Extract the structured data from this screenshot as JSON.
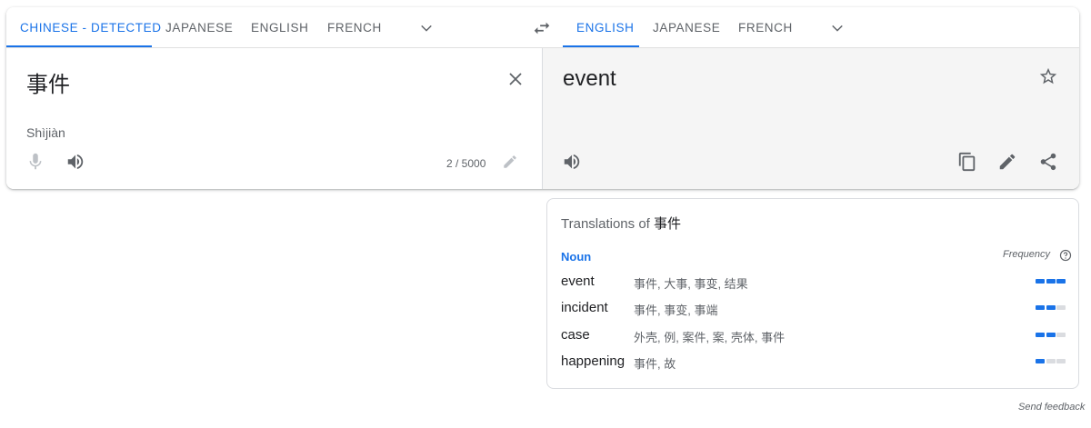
{
  "source_tabs": [
    {
      "label": "Chinese - detected",
      "active": true
    },
    {
      "label": "Japanese",
      "active": false
    },
    {
      "label": "English",
      "active": false
    },
    {
      "label": "French",
      "active": false
    }
  ],
  "target_tabs": [
    {
      "label": "English",
      "active": true
    },
    {
      "label": "Japanese",
      "active": false
    },
    {
      "label": "French",
      "active": false
    }
  ],
  "source": {
    "text": "事件",
    "romanization": "Shìjiàn",
    "char_count": "2 / 5000"
  },
  "target": {
    "text": "event"
  },
  "dictionary": {
    "title_prefix": "Translations of",
    "term": "事件",
    "part_of_speech": "Noun",
    "frequency_label": "Frequency",
    "entries": [
      {
        "word": "event",
        "synonyms": "事件, 大事, 事变, 结果",
        "frequency": 3
      },
      {
        "word": "incident",
        "synonyms": "事件, 事变, 事端",
        "frequency": 2
      },
      {
        "word": "case",
        "synonyms": "外壳, 例, 案件, 案, 壳体, 事件",
        "frequency": 2
      },
      {
        "word": "happening",
        "synonyms": "事件, 故",
        "frequency": 1
      }
    ]
  },
  "feedback": "Send feedback",
  "colors": {
    "accent": "#1a73e8",
    "muted": "#5f6368",
    "target_bg": "#f5f5f5",
    "bar_off": "#dadce0"
  },
  "icons": {
    "swap": "swap-horiz-icon",
    "clear": "close-icon",
    "mic": "mic-icon",
    "speaker": "volume-up-icon",
    "edit": "pencil-icon",
    "star": "star-outline-icon",
    "copy": "copy-icon",
    "share": "share-icon",
    "help": "help-circle-icon",
    "more": "chevron-down-icon"
  }
}
